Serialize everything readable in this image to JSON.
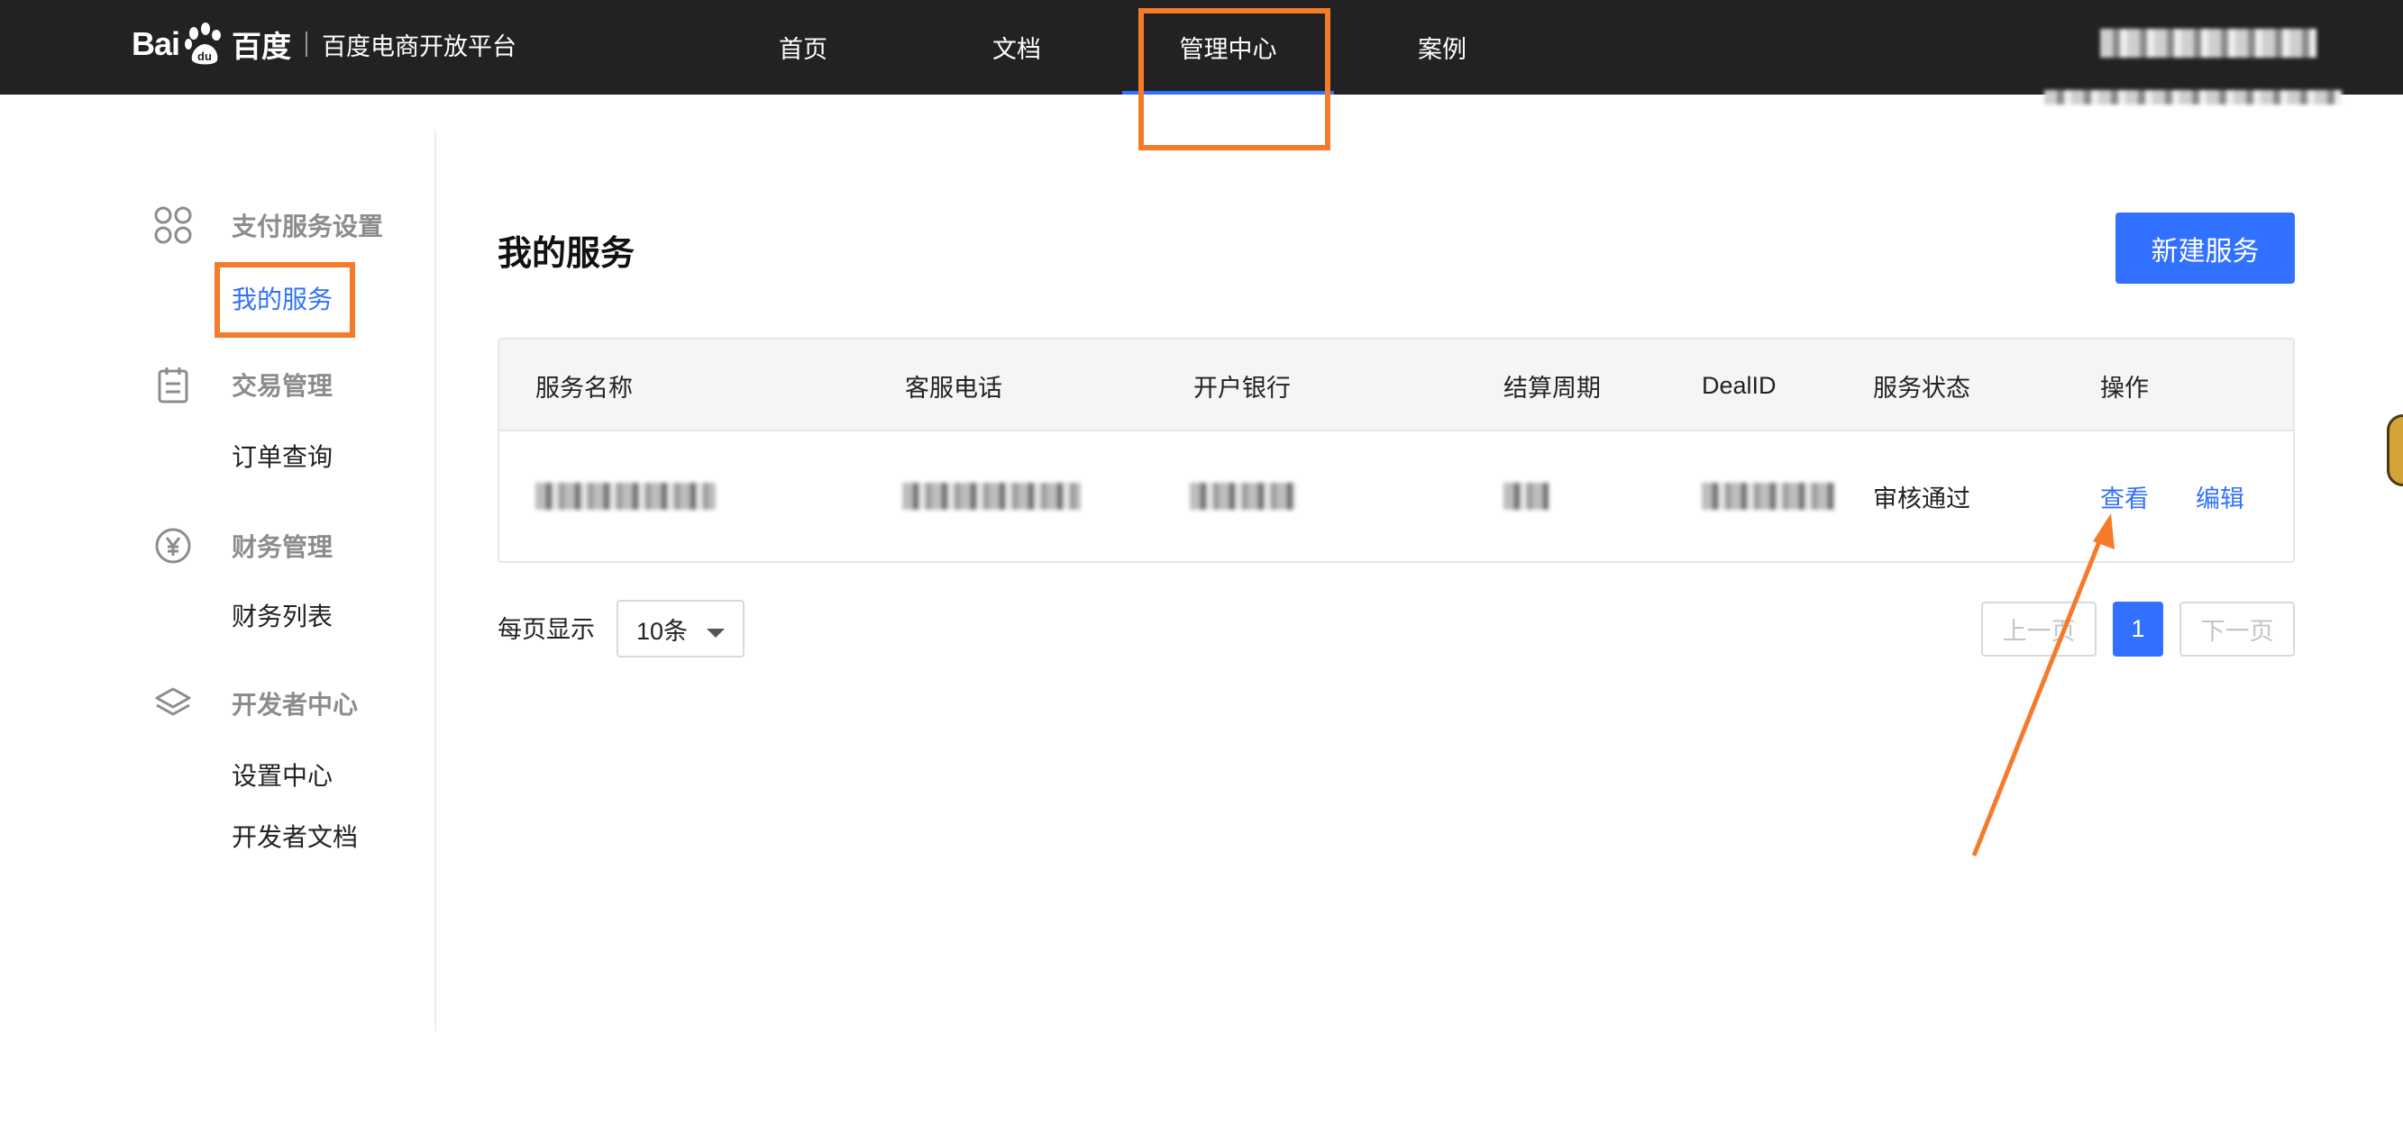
{
  "header": {
    "logo_text_latin": "Bai",
    "logo_text_cn": "百度",
    "platform_name": "百度电商开放平台",
    "nav": [
      {
        "label": "首页"
      },
      {
        "label": "文档"
      },
      {
        "label": "管理中心"
      },
      {
        "label": "案例"
      }
    ],
    "active_nav": "管理中心"
  },
  "sidebar": {
    "groups": [
      {
        "label": "支付服务设置",
        "icon": "apps-grid-icon",
        "items": [
          {
            "label": "我的服务"
          }
        ]
      },
      {
        "label": "交易管理",
        "icon": "clipboard-icon",
        "items": [
          {
            "label": "订单查询"
          }
        ]
      },
      {
        "label": "财务管理",
        "icon": "yen-circle-icon",
        "items": [
          {
            "label": "财务列表"
          }
        ]
      },
      {
        "label": "开发者中心",
        "icon": "layers-icon",
        "items": [
          {
            "label": "设置中心"
          },
          {
            "label": "开发者文档"
          }
        ]
      }
    ],
    "active_item": "我的服务"
  },
  "main": {
    "title": "我的服务",
    "new_button": "新建服务",
    "table": {
      "columns": [
        "服务名称",
        "客服电话",
        "开户银行",
        "结算周期",
        "DealID",
        "服务状态",
        "操作"
      ],
      "rows": [
        {
          "status": "审核通过",
          "actions": [
            "查看",
            "编辑"
          ]
        }
      ]
    },
    "pagination": {
      "page_size_label": "每页显示",
      "page_size": "10条",
      "prev": "上一页",
      "current_page": "1",
      "next": "下一页"
    }
  },
  "colors": {
    "topbar": "#222222",
    "accent": "#3271ff",
    "annotation": "#f47b2a"
  }
}
